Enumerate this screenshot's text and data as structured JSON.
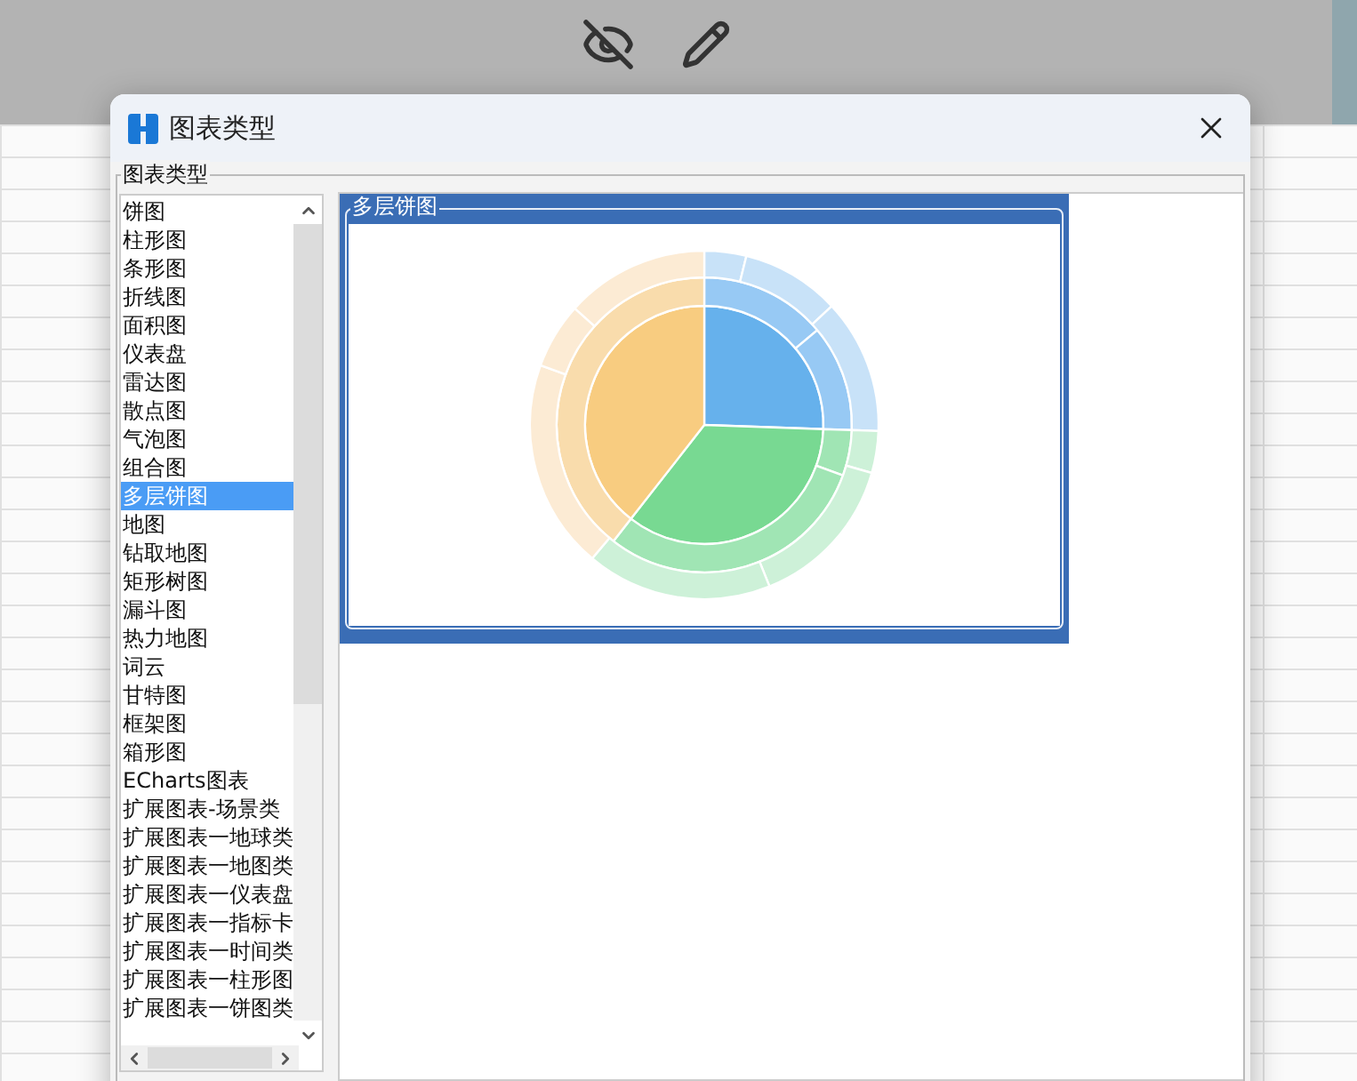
{
  "window": {
    "title": "图表类型"
  },
  "group_label": "图表类型",
  "chart_types": [
    {
      "label": "饼图",
      "selected": false
    },
    {
      "label": "柱形图",
      "selected": false
    },
    {
      "label": "条形图",
      "selected": false
    },
    {
      "label": "折线图",
      "selected": false
    },
    {
      "label": "面积图",
      "selected": false
    },
    {
      "label": "仪表盘",
      "selected": false
    },
    {
      "label": "雷达图",
      "selected": false
    },
    {
      "label": "散点图",
      "selected": false
    },
    {
      "label": "气泡图",
      "selected": false
    },
    {
      "label": "组合图",
      "selected": false
    },
    {
      "label": "多层饼图",
      "selected": true
    },
    {
      "label": "地图",
      "selected": false
    },
    {
      "label": "钻取地图",
      "selected": false
    },
    {
      "label": "矩形树图",
      "selected": false
    },
    {
      "label": "漏斗图",
      "selected": false
    },
    {
      "label": "热力地图",
      "selected": false
    },
    {
      "label": "词云",
      "selected": false
    },
    {
      "label": "甘特图",
      "selected": false
    },
    {
      "label": "框架图",
      "selected": false
    },
    {
      "label": "箱形图",
      "selected": false
    },
    {
      "label": "ECharts图表",
      "selected": false
    },
    {
      "label": "扩展图表-场景类",
      "selected": false
    },
    {
      "label": "扩展图表一地球类",
      "selected": false
    },
    {
      "label": "扩展图表一地图类",
      "selected": false
    },
    {
      "label": "扩展图表一仪表盘",
      "selected": false
    },
    {
      "label": "扩展图表一指标卡",
      "selected": false
    },
    {
      "label": "扩展图表一时间类",
      "selected": false
    },
    {
      "label": "扩展图表一柱形图",
      "selected": false
    },
    {
      "label": "扩展图表一饼图类",
      "selected": false
    }
  ],
  "preview": {
    "title": "多层饼图",
    "selected": true
  }
}
